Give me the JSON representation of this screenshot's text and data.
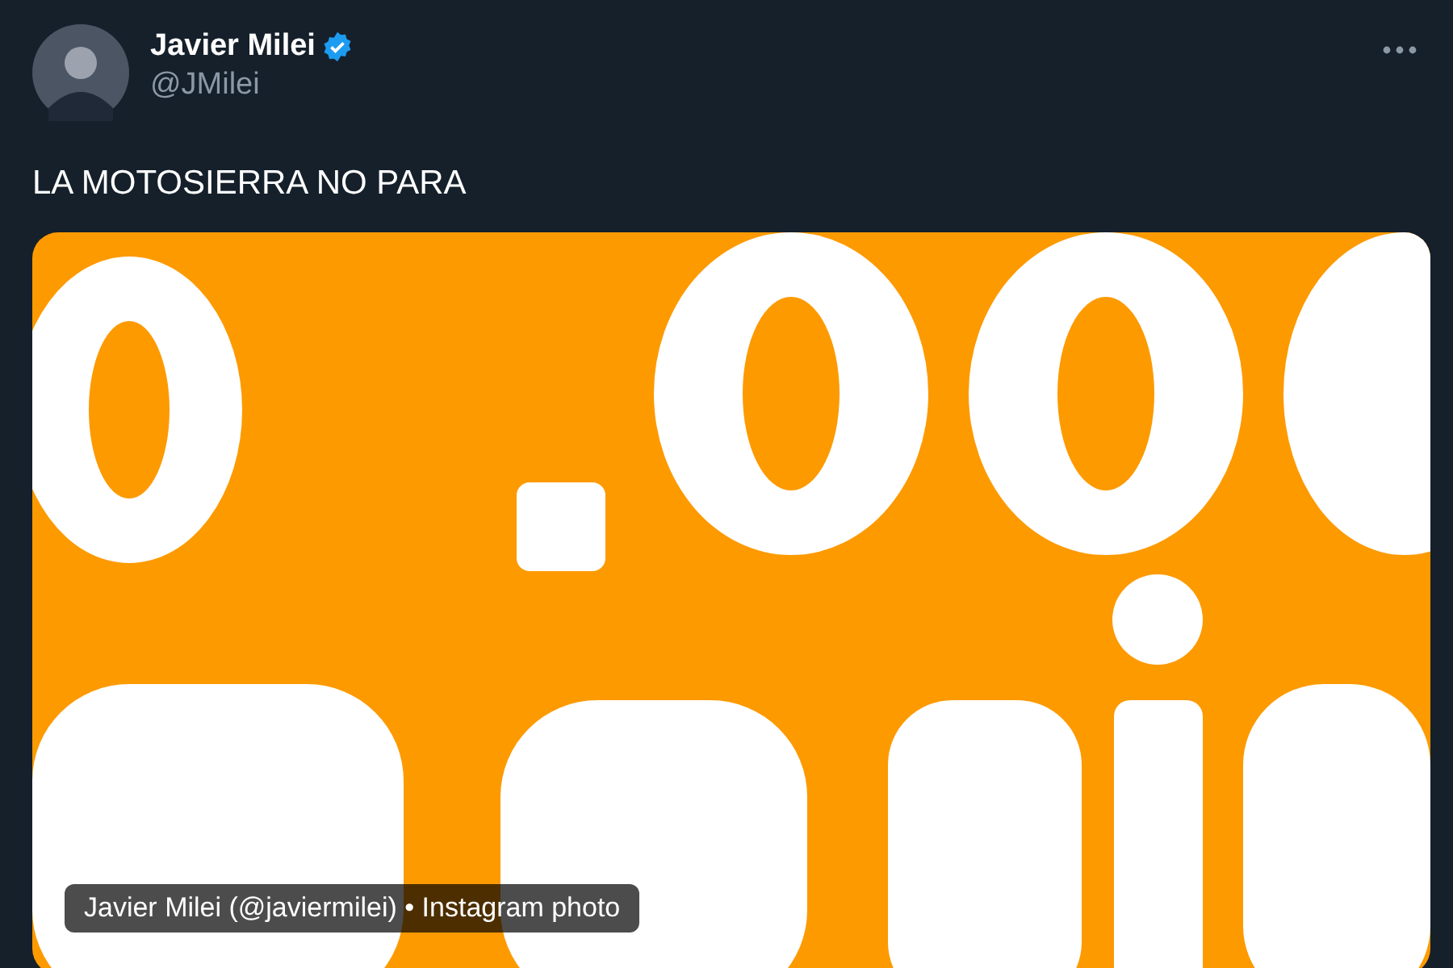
{
  "author": {
    "name": "Javier Milei",
    "verified": true,
    "handle": "@JMilei"
  },
  "text": "LA MOTOSIERRA NO PARA",
  "media": {
    "kind": "picture",
    "caption": "Javier Milei (@javiermilei) • Instagram photo"
  }
}
